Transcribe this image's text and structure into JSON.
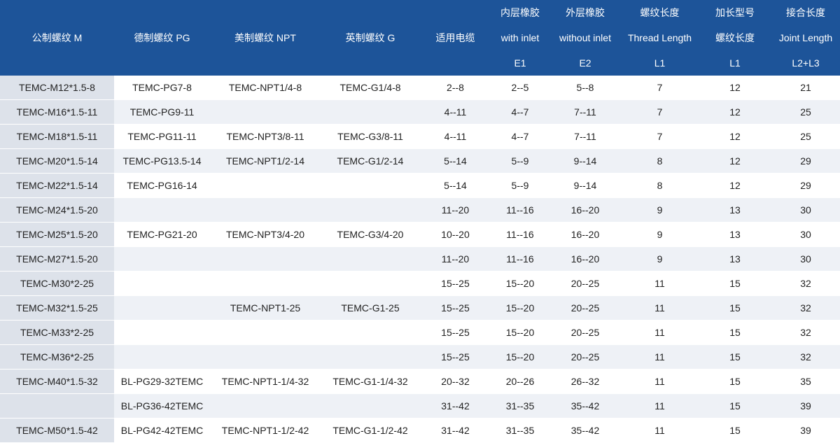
{
  "headers": [
    {
      "lines": [
        "公制螺纹 M"
      ]
    },
    {
      "lines": [
        "德制螺纹 PG"
      ]
    },
    {
      "lines": [
        "美制螺纹 NPT"
      ]
    },
    {
      "lines": [
        "英制螺纹 G"
      ]
    },
    {
      "lines": [
        "适用电缆"
      ]
    },
    {
      "lines": [
        "内层橡胶",
        "with inlet",
        "E1"
      ]
    },
    {
      "lines": [
        "外层橡胶",
        "without inlet",
        "E2"
      ]
    },
    {
      "lines": [
        "螺纹长度",
        "Thread Length",
        "L1"
      ]
    },
    {
      "lines": [
        "加长型号",
        "螺纹长度",
        "L1"
      ]
    },
    {
      "lines": [
        "接合长度",
        "Joint Length",
        "L2+L3"
      ]
    }
  ],
  "rows": [
    [
      "TEMC-M12*1.5-8",
      "TEMC-PG7-8",
      "TEMC-NPT1/4-8",
      "TEMC-G1/4-8",
      "2--8",
      "2--5",
      "5--8",
      "7",
      "12",
      "21"
    ],
    [
      "TEMC-M16*1.5-11",
      "TEMC-PG9-11",
      "",
      "",
      "4--11",
      "4--7",
      "7--11",
      "7",
      "12",
      "25"
    ],
    [
      "TEMC-M18*1.5-11",
      "TEMC-PG11-11",
      "TEMC-NPT3/8-11",
      "TEMC-G3/8-11",
      "4--11",
      "4--7",
      "7--11",
      "7",
      "12",
      "25"
    ],
    [
      "TEMC-M20*1.5-14",
      "TEMC-PG13.5-14",
      "TEMC-NPT1/2-14",
      "TEMC-G1/2-14",
      "5--14",
      "5--9",
      "9--14",
      "8",
      "12",
      "29"
    ],
    [
      "TEMC-M22*1.5-14",
      "TEMC-PG16-14",
      "",
      "",
      "5--14",
      "5--9",
      "9--14",
      "8",
      "12",
      "29"
    ],
    [
      "TEMC-M24*1.5-20",
      "",
      "",
      "",
      "11--20",
      "11--16",
      "16--20",
      "9",
      "13",
      "30"
    ],
    [
      "TEMC-M25*1.5-20",
      "TEMC-PG21-20",
      "TEMC-NPT3/4-20",
      "TEMC-G3/4-20",
      "10--20",
      "11--16",
      "16--20",
      "9",
      "13",
      "30"
    ],
    [
      "TEMC-M27*1.5-20",
      "",
      "",
      "",
      "11--20",
      "11--16",
      "16--20",
      "9",
      "13",
      "30"
    ],
    [
      "TEMC-M30*2-25",
      "",
      "",
      "",
      "15--25",
      "15--20",
      "20--25",
      "11",
      "15",
      "32"
    ],
    [
      "TEMC-M32*1.5-25",
      "",
      "TEMC-NPT1-25",
      "TEMC-G1-25",
      "15--25",
      "15--20",
      "20--25",
      "11",
      "15",
      "32"
    ],
    [
      "TEMC-M33*2-25",
      "",
      "",
      "",
      "15--25",
      "15--20",
      "20--25",
      "11",
      "15",
      "32"
    ],
    [
      "TEMC-M36*2-25",
      "",
      "",
      "",
      "15--25",
      "15--20",
      "20--25",
      "11",
      "15",
      "32"
    ],
    [
      "TEMC-M40*1.5-32",
      "BL-PG29-32TEMC",
      "TEMC-NPT1-1/4-32",
      "TEMC-G1-1/4-32",
      "20--32",
      "20--26",
      "26--32",
      "11",
      "15",
      "35"
    ],
    [
      "",
      "BL-PG36-42TEMC",
      "",
      "",
      "31--42",
      "31--35",
      "35--42",
      "11",
      "15",
      "39"
    ],
    [
      "TEMC-M50*1.5-42",
      "BL-PG42-42TEMC",
      "TEMC-NPT1-1/2-42",
      "TEMC-G1-1/2-42",
      "31--42",
      "31--35",
      "35--42",
      "11",
      "15",
      "39"
    ]
  ],
  "colors": {
    "header_bg": "#1d5499",
    "first_col_bg": "#dde2ea",
    "stripe_bg": "#eef1f6"
  }
}
